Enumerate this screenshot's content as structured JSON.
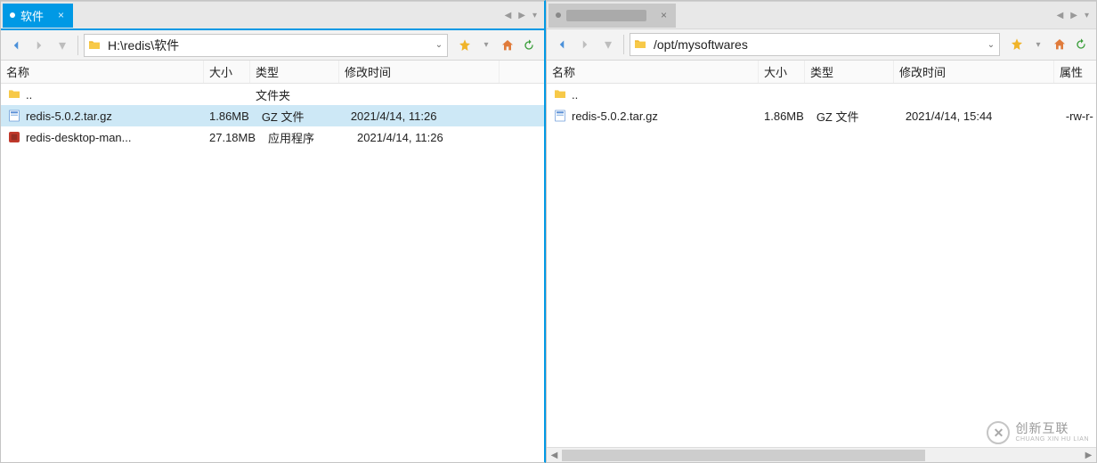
{
  "left": {
    "tab_label": "软件",
    "path": "H:\\redis\\软件",
    "columns": {
      "name": "名称",
      "size": "大小",
      "type": "类型",
      "date": "修改时间"
    },
    "rows": [
      {
        "icon": "folder-up",
        "name": "..",
        "size": "",
        "type": "文件夹",
        "date": ""
      },
      {
        "icon": "archive",
        "name": "redis-5.0.2.tar.gz",
        "size": "1.86MB",
        "type": "GZ 文件",
        "date": "2021/4/14, 11:26",
        "selected": true
      },
      {
        "icon": "app",
        "name": "redis-desktop-man...",
        "size": "27.18MB",
        "type": "应用程序",
        "date": "2021/4/14, 11:26"
      }
    ]
  },
  "right": {
    "tab_label": "(blurred)",
    "path": "/opt/mysoftwares",
    "columns": {
      "name": "名称",
      "size": "大小",
      "type": "类型",
      "date": "修改时间",
      "attr": "属性"
    },
    "rows": [
      {
        "icon": "folder-up",
        "name": "..",
        "size": "",
        "type": "",
        "date": "",
        "attr": ""
      },
      {
        "icon": "archive",
        "name": "redis-5.0.2.tar.gz",
        "size": "1.86MB",
        "type": "GZ 文件",
        "date": "2021/4/14, 15:44",
        "attr": "-rw-r-"
      }
    ]
  },
  "watermark": {
    "brand": "创新互联",
    "sub": "CHUANG XIN HU LIAN"
  }
}
